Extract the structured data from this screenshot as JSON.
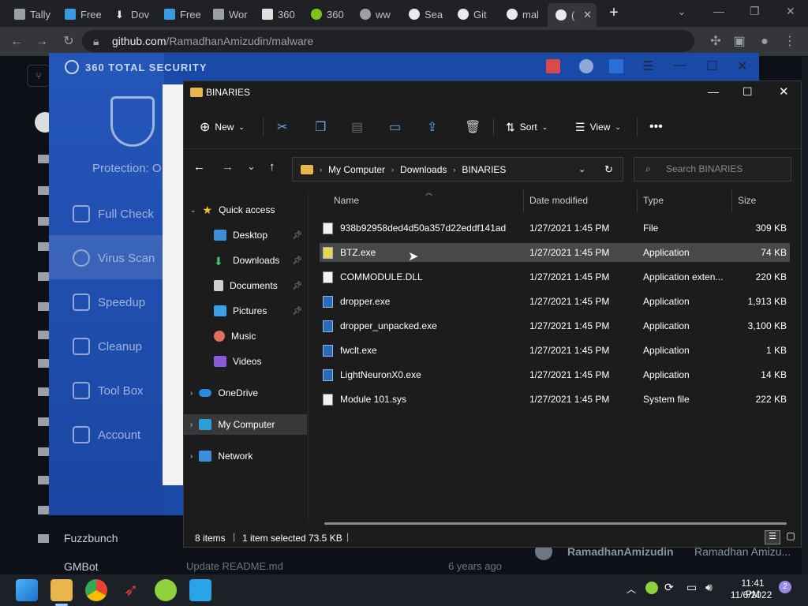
{
  "browser": {
    "tabs": [
      {
        "label": "Tally"
      },
      {
        "label": "Free"
      },
      {
        "label": "Dov"
      },
      {
        "label": "Free"
      },
      {
        "label": "Wor"
      },
      {
        "label": "360"
      },
      {
        "label": "360"
      },
      {
        "label": "ww"
      },
      {
        "label": "Sea"
      },
      {
        "label": "Git"
      },
      {
        "label": "mal"
      },
      {
        "label": "("
      }
    ],
    "new_tab": "+",
    "url_host": "github.com",
    "url_path": "/RamadhanAmizudin/malware"
  },
  "github": {
    "folders": [
      {
        "name": ""
      },
      {
        "name": ""
      },
      {
        "name": ""
      },
      {
        "name": ""
      },
      {
        "name": ""
      },
      {
        "name": ""
      },
      {
        "name": ""
      },
      {
        "name": ""
      },
      {
        "name": ""
      },
      {
        "name": ""
      },
      {
        "name": ""
      },
      {
        "name": ""
      },
      {
        "name": "Fuzzbunch"
      },
      {
        "name": "GMBot"
      }
    ],
    "commit_text": "Update README.md",
    "commit_age": "6 years ago",
    "author": "RamadhanAmizudin",
    "author_full": "Ramadhan Amizu..."
  },
  "security360": {
    "brand": "360 TOTAL SECURITY",
    "protection": "Protection: O",
    "menu": [
      "Full Check",
      "Virus Scan",
      "Speedup",
      "Cleanup",
      "Tool Box",
      "Account"
    ]
  },
  "explorer": {
    "title": "BINARIES",
    "toolbar": {
      "new": "New",
      "sort": "Sort",
      "view": "View"
    },
    "breadcrumb": [
      "My Computer",
      "Downloads",
      "BINARIES"
    ],
    "search_placeholder": "Search BINARIES",
    "nav": {
      "quick_access": "Quick access",
      "pinned": [
        "Desktop",
        "Downloads",
        "Documents",
        "Pictures"
      ],
      "others": [
        "Music",
        "Videos"
      ],
      "onedrive": "OneDrive",
      "my_computer": "My Computer",
      "network": "Network"
    },
    "columns": {
      "name": "Name",
      "date": "Date modified",
      "type": "Type",
      "size": "Size"
    },
    "files": [
      {
        "name": "938b92958ded4d50a357d22eddf141ad",
        "date": "1/27/2021 1:45 PM",
        "type": "File",
        "size": "309 KB",
        "icon": "file"
      },
      {
        "name": "BTZ.exe",
        "date": "1/27/2021 1:45 PM",
        "type": "Application",
        "size": "74 KB",
        "icon": "app"
      },
      {
        "name": "COMMODULE.DLL",
        "date": "1/27/2021 1:45 PM",
        "type": "Application exten...",
        "size": "220 KB",
        "icon": "file"
      },
      {
        "name": "dropper.exe",
        "date": "1/27/2021 1:45 PM",
        "type": "Application",
        "size": "1,913 KB",
        "icon": "app"
      },
      {
        "name": "dropper_unpacked.exe",
        "date": "1/27/2021 1:45 PM",
        "type": "Application",
        "size": "3,100 KB",
        "icon": "app"
      },
      {
        "name": "fwclt.exe",
        "date": "1/27/2021 1:45 PM",
        "type": "Application",
        "size": "1 KB",
        "icon": "app"
      },
      {
        "name": "LightNeuronX0.exe",
        "date": "1/27/2021 1:45 PM",
        "type": "Application",
        "size": "14 KB",
        "icon": "app"
      },
      {
        "name": "Module 101.sys",
        "date": "1/27/2021 1:45 PM",
        "type": "System file",
        "size": "222 KB",
        "icon": "file"
      }
    ],
    "status": {
      "count": "8 items",
      "selected": "1 item selected",
      "size": "73.5 KB"
    }
  },
  "taskbar": {
    "time": "11:41 PM",
    "date": "11/6/2022",
    "badge": "2"
  }
}
